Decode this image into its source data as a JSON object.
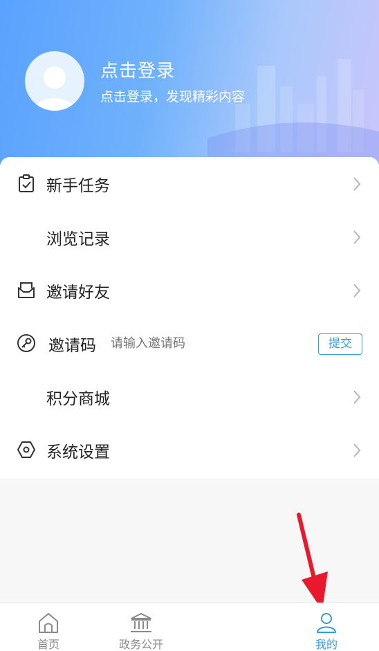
{
  "header": {
    "login_title": "点击登录",
    "login_subtitle": "点击登录，发现精彩内容"
  },
  "menu": {
    "items": [
      {
        "label": "新手任务",
        "icon": "clipboard-check-icon"
      },
      {
        "label": "浏览记录",
        "icon": ""
      },
      {
        "label": "邀请好友",
        "icon": "mail-invite-icon"
      },
      {
        "label": "邀请码",
        "icon": "key-circle-icon",
        "placeholder": "请输入邀请码",
        "button": "提交"
      },
      {
        "label": "积分商城",
        "icon": ""
      },
      {
        "label": "系统设置",
        "icon": "hexagon-settings-icon"
      }
    ]
  },
  "bottom_nav": {
    "items": [
      {
        "label": "首页",
        "icon": "home-icon"
      },
      {
        "label": "政务公开",
        "icon": "bank-icon"
      },
      {
        "label": "我的",
        "icon": "user-icon",
        "active": true
      }
    ]
  },
  "colors": {
    "accent": "#2f9ddd",
    "header_start": "#5aa2ff",
    "header_end": "#c9c6fb",
    "annotation_arrow": "#e8192c"
  }
}
